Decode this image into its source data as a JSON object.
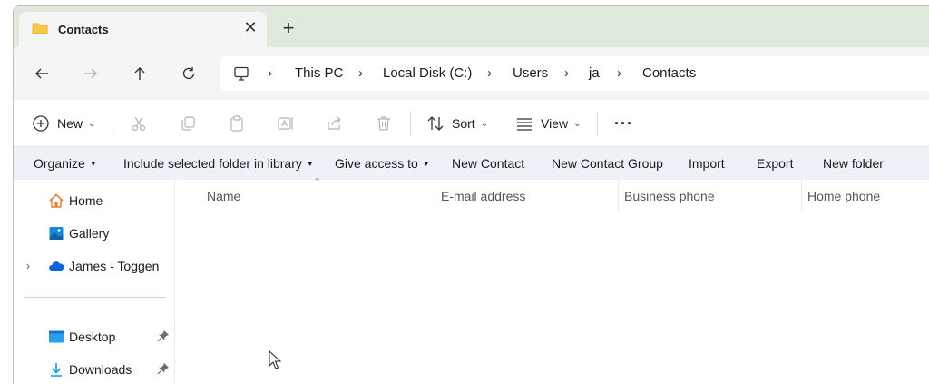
{
  "tab": {
    "title": "Contacts",
    "close": "✕",
    "new_tab": "+"
  },
  "breadcrumb": [
    "This PC",
    "Local Disk (C:)",
    "Users",
    "ja",
    "Contacts"
  ],
  "breadcrumb_separator": "›",
  "command_bar": {
    "new_label": "New",
    "sort_label": "Sort",
    "view_label": "View",
    "more_label": "···"
  },
  "menu_bar": {
    "organize": "Organize",
    "include": "Include selected folder in library",
    "give_access": "Give access to",
    "new_contact": "New Contact",
    "new_contact_group": "New Contact Group",
    "import": "Import",
    "export": "Export",
    "new_folder": "New folder"
  },
  "nav_pane": {
    "home": "Home",
    "gallery": "Gallery",
    "onedrive": "James - Toggen",
    "desktop": "Desktop",
    "downloads": "Downloads"
  },
  "columns": {
    "name": "Name",
    "email": "E-mail address",
    "business_phone": "Business phone",
    "home_phone": "Home phone"
  },
  "colors": {
    "titlebar": "#dfe9dc",
    "tab_active": "#f3f6f2",
    "menubar": "#eef1f7",
    "folder_yellow": "#f8c843",
    "onedrive_blue": "#0a64d8"
  }
}
